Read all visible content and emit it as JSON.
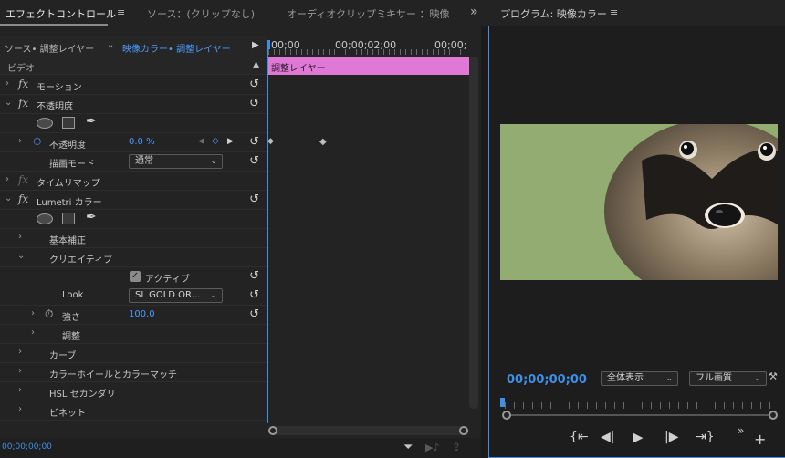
{
  "tabs": {
    "effect_controls": "エフェクトコントロール",
    "source": "ソース：(クリップなし)",
    "audio_mixer": "オーディオクリップミキサー ：映像カ",
    "program": "プログラム: 映像カラー",
    "menu_icon": "≡",
    "overflow_icon": "»"
  },
  "effect_controls": {
    "source_label": "ソース• 調整レイヤー",
    "sequence_label": "映像カラー• 調整レイヤー",
    "video_header": "ビデオ",
    "motion": "モーション",
    "opacity_group": "不透明度",
    "opacity_prop": "不透明度",
    "opacity_value": "0.0 %",
    "blend_mode_label": "描画モード",
    "blend_mode_value": "通常",
    "time_remap": "タイムリマップ",
    "lumetri": "Lumetri カラー",
    "basic_correction": "基本補正",
    "creative": "クリエイティブ",
    "active_label": "アクティブ",
    "look_label": "Look",
    "look_value": "SL GOLD OR...",
    "intensity_label": "強さ",
    "intensity_value": "100.0",
    "adjust": "調整",
    "curves": "カーブ",
    "color_wheels": "カラーホイールとカラーマッチ",
    "hsl": "HSL セカンダリ",
    "vignette": "ビネット",
    "current_time": "00;00;00;00"
  },
  "timeline": {
    "ruler_start": "00;00",
    "ruler_mid": "00;00;02;00",
    "ruler_end": "00;00;",
    "clip_label": "調整レイヤー"
  },
  "program": {
    "timecode": "00;00;00;00",
    "zoom_value": "全体表示",
    "quality_value": "フル画質"
  },
  "colors": {
    "accent": "#3d8fe8",
    "clip": "#e079d6"
  }
}
